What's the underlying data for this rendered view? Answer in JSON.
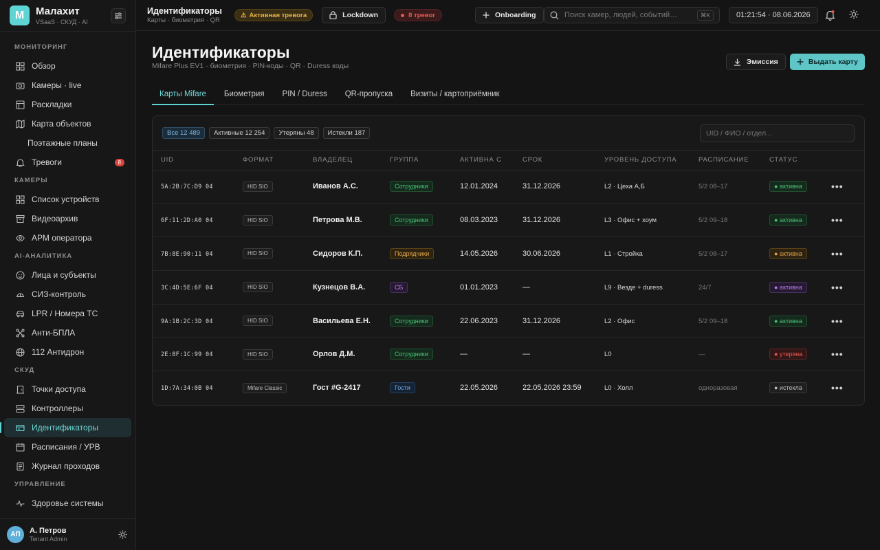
{
  "brand": {
    "logo_letter": "М",
    "name": "Малахит",
    "subtitle": "VSaaS · СКУД · AI"
  },
  "sidebar": {
    "sections": [
      {
        "title": "Мониторинг",
        "items": [
          {
            "label": "Обзор",
            "icon": "grid-icon"
          },
          {
            "label": "Камеры · live",
            "icon": "camera-icon"
          },
          {
            "label": "Раскладки",
            "icon": "layout-icon"
          },
          {
            "label": "Карта объектов",
            "icon": "map-icon"
          },
          {
            "label": "Поэтажные планы",
            "icon": "",
            "sub": true
          },
          {
            "label": "Тревоги",
            "icon": "bell-icon",
            "badge": "8"
          }
        ]
      },
      {
        "title": "Камеры",
        "items": [
          {
            "label": "Список устройств",
            "icon": "grid-icon"
          },
          {
            "label": "Видеоархив",
            "icon": "archive-icon"
          },
          {
            "label": "АРМ оператора",
            "icon": "eye-icon"
          }
        ]
      },
      {
        "title": "AI-аналитика",
        "items": [
          {
            "label": "Лица и субъекты",
            "icon": "face-icon"
          },
          {
            "label": "СИЗ-контроль",
            "icon": "helmet-icon"
          },
          {
            "label": "LPR / Номера ТС",
            "icon": "car-icon"
          },
          {
            "label": "Анти-БПЛА",
            "icon": "drone-icon"
          },
          {
            "label": "112 Антидрон",
            "icon": "globe-icon"
          }
        ]
      },
      {
        "title": "СКУД",
        "items": [
          {
            "label": "Точки доступа",
            "icon": "door-icon"
          },
          {
            "label": "Контроллеры",
            "icon": "server-icon"
          },
          {
            "label": "Идентификаторы",
            "icon": "card-icon",
            "active": true
          },
          {
            "label": "Расписания / УРВ",
            "icon": "calendar-icon"
          },
          {
            "label": "Журнал проходов",
            "icon": "journal-icon"
          }
        ]
      },
      {
        "title": "Управление",
        "items": [
          {
            "label": "Здоровье системы",
            "icon": "pulse-icon"
          }
        ]
      }
    ]
  },
  "user": {
    "initials": "АП",
    "name": "А. Петров",
    "role": "Tenant Admin"
  },
  "topbar": {
    "title": "Идентификаторы",
    "breadcrumb": "Карты · биометрия · QR",
    "alert_label": "Активная тревога",
    "lockdown_label": "Lockdown",
    "alarms_label": "8 тревог",
    "onboarding_label": "Onboarding",
    "search_placeholder": "Поиск камер, людей, событий…",
    "search_shortcut": "⌘K",
    "clock": "01:21:54 · 08.06.2026"
  },
  "page": {
    "title": "Идентификаторы",
    "subtitle": "Mifare Plus EV1 · биометрия · PIN-коды · QR · Duress коды",
    "emission_label": "Эмиссия",
    "issue_label": "Выдать карту"
  },
  "tabs": [
    "Карты Mifare",
    "Биометрия",
    "PIN / Duress",
    "QR-пропуска",
    "Визиты / картоприёмник"
  ],
  "filters": {
    "chips": [
      "Все 12 489",
      "Активные 12 254",
      "Утеряны 48",
      "Истекли 187"
    ],
    "search_placeholder": "UID / ФИО / отдел..."
  },
  "table": {
    "headers": [
      "UID",
      "Формат",
      "Владелец",
      "Группа",
      "Активна с",
      "Срок",
      "Уровень доступа",
      "Расписание",
      "Статус"
    ],
    "rows": [
      {
        "uid": "5A:2B:7C:D9 04",
        "format": "HID SIO",
        "owner": "Иванов А.С.",
        "group": "Сотрудники",
        "group_color": "green",
        "active_from": "12.01.2024",
        "expires": "31.12.2026",
        "access": "L2 · Цеха А,Б",
        "schedule": "5/2 08–17",
        "status": "● активна",
        "status_color": "green"
      },
      {
        "uid": "6F:11:2D:A0 04",
        "format": "HID SIO",
        "owner": "Петрова М.В.",
        "group": "Сотрудники",
        "group_color": "green",
        "active_from": "08.03.2023",
        "expires": "31.12.2026",
        "access": "L3 · Офис + хоум",
        "schedule": "5/2 09–18",
        "status": "● активна",
        "status_color": "green"
      },
      {
        "uid": "7B:8E:90:11 04",
        "format": "HID SIO",
        "owner": "Сидоров К.П.",
        "group": "Подрядчики",
        "group_color": "orange",
        "active_from": "14.05.2026",
        "expires": "30.06.2026",
        "access": "L1 · Стройка",
        "schedule": "5/2 08–17",
        "status": "● активна",
        "status_color": "orange"
      },
      {
        "uid": "3C:4D:5E:6F 04",
        "format": "HID SIO",
        "owner": "Кузнецов В.А.",
        "group": "СБ",
        "group_color": "purple",
        "active_from": "01.01.2023",
        "expires": "—",
        "access": "L9 · Везде + duress",
        "schedule": "24/7",
        "status": "● активна",
        "status_color": "purple"
      },
      {
        "uid": "9A:1B:2C:3D 04",
        "format": "HID SIO",
        "owner": "Васильева Е.Н.",
        "group": "Сотрудники",
        "group_color": "green",
        "active_from": "22.06.2023",
        "expires": "31.12.2026",
        "access": "L2 · Офис",
        "schedule": "5/2 09–18",
        "status": "● активна",
        "status_color": "green"
      },
      {
        "uid": "2E:8F:1C:99 04",
        "format": "HID SIO",
        "owner": "Орлов Д.М.",
        "group": "Сотрудники",
        "group_color": "green",
        "active_from": "—",
        "expires": "—",
        "access": "L0",
        "schedule": "—",
        "status": "● утеряна",
        "status_color": "red"
      },
      {
        "uid": "1D:7A:34:0B 04",
        "format": "Mifare Classic",
        "owner": "Гост #G-2417",
        "group": "Гости",
        "group_color": "blue",
        "active_from": "22.05.2026",
        "expires": "22.05.2026 23:59",
        "access": "L0 · Холл",
        "schedule": "одноразовая",
        "status": "● истекла",
        "status_color": "gray"
      }
    ]
  },
  "colors": {
    "accent": "#5fd4d4",
    "background": "#141414",
    "alert": "#e05a52"
  }
}
